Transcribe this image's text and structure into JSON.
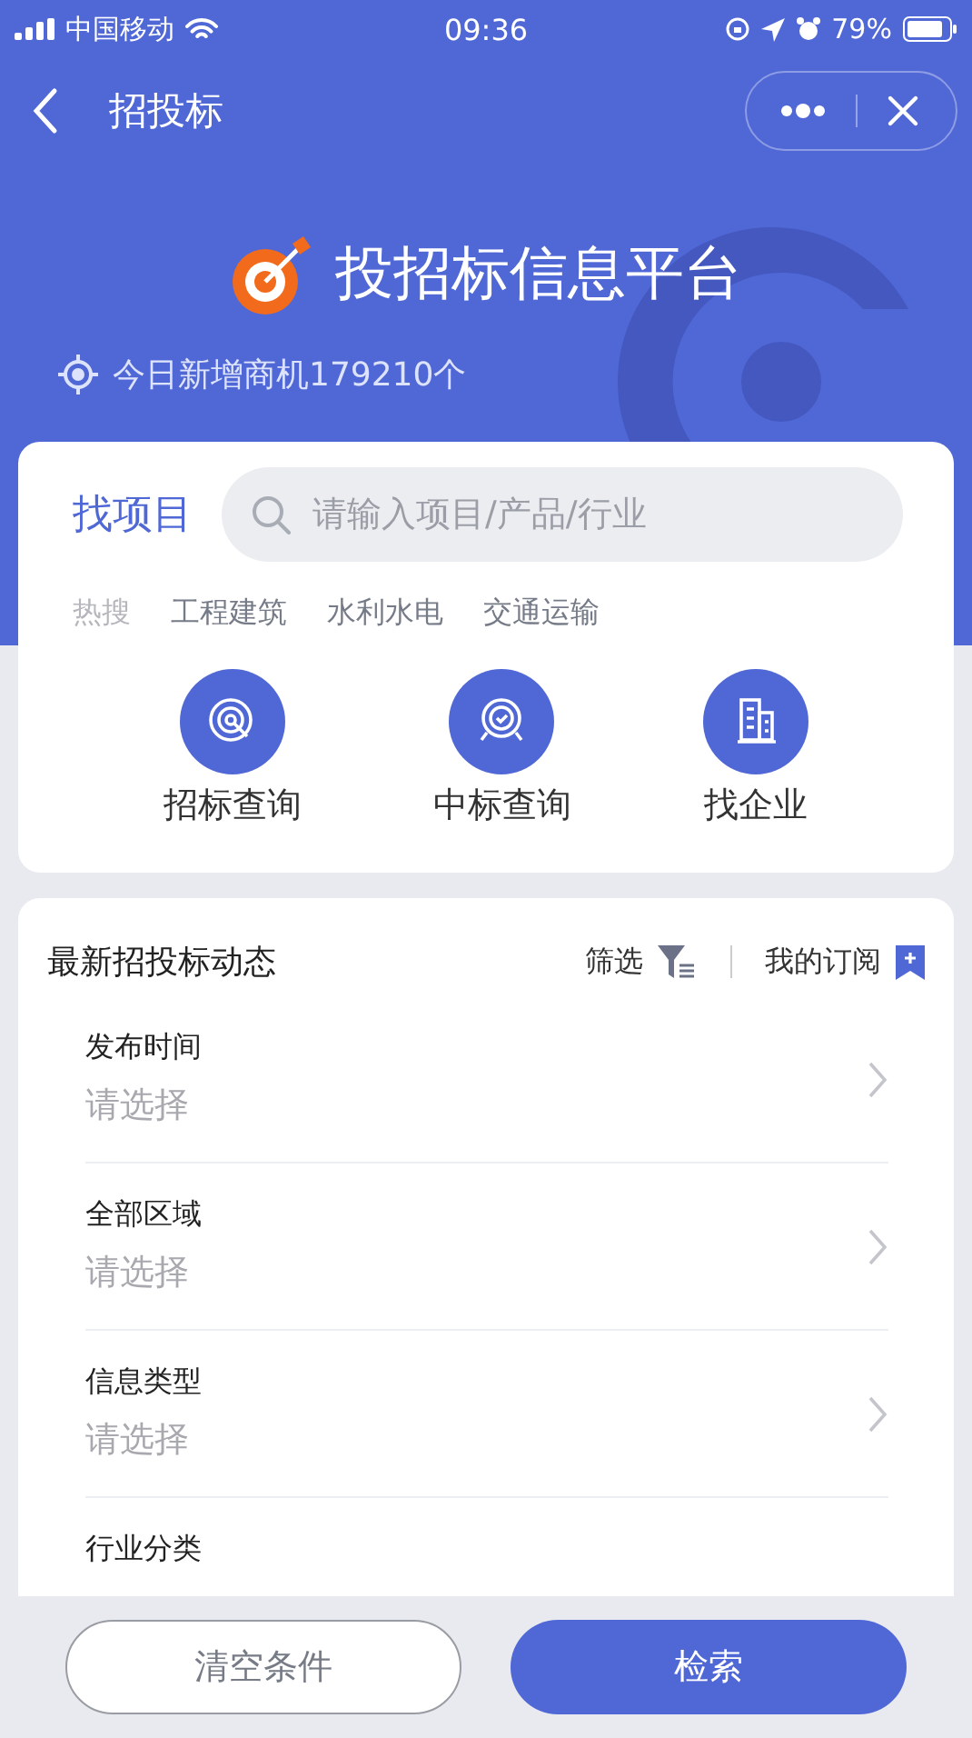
{
  "status_bar": {
    "carrier": "中国移动",
    "time": "09:36",
    "battery": "79%"
  },
  "nav": {
    "title": "招投标"
  },
  "header": {
    "title": "投招标信息平台",
    "subtitle": "今日新增商机179210个"
  },
  "search_card": {
    "label": "找项目",
    "search": {
      "placeholder": "请输入项目/产品/行业"
    },
    "hot_label": "热搜",
    "hot_tags": [
      "工程建筑",
      "水利水电",
      "交通运输"
    ],
    "shortcuts": [
      {
        "kind": "tender",
        "label": "招标查询"
      },
      {
        "kind": "award",
        "label": "中标查询"
      },
      {
        "kind": "company",
        "label": "找企业"
      }
    ]
  },
  "feed": {
    "title": "最新招投标动态",
    "filter": "筛选",
    "subscribe": "我的订阅",
    "filters": [
      {
        "label": "发布时间",
        "value": "请选择"
      },
      {
        "label": "全部区域",
        "value": "请选择"
      },
      {
        "label": "信息类型",
        "value": "请选择"
      },
      {
        "label": "行业分类"
      }
    ]
  },
  "buttons": {
    "clear": "清空条件",
    "search": "检索"
  }
}
